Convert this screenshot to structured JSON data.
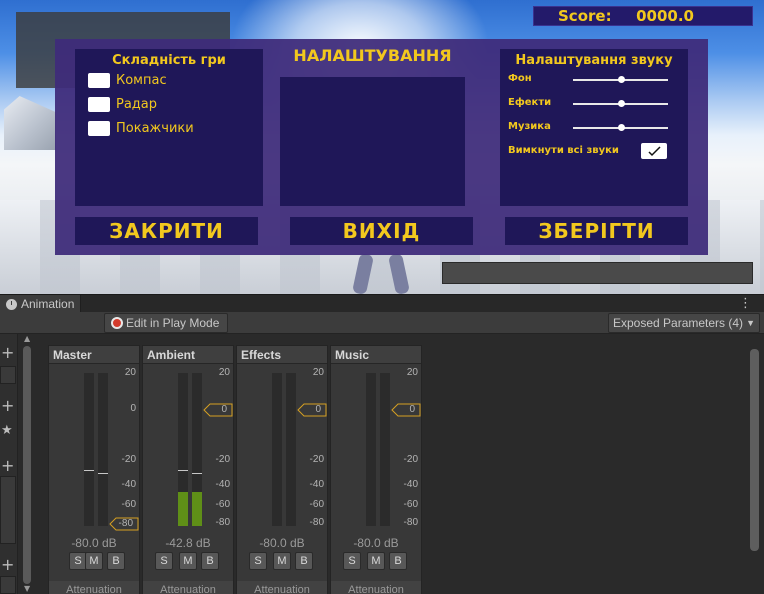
{
  "game": {
    "score_label": "Score:",
    "score_value": "0000.0",
    "settings_title": "НАЛАШТУВАННЯ",
    "difficulty": {
      "title": "Складність гри",
      "options": [
        "Компас",
        "Радар",
        "Покажчики"
      ]
    },
    "sound": {
      "title": "Налаштування звуку",
      "sliders": [
        {
          "label": "Фон",
          "value": 0.5
        },
        {
          "label": "Ефекти",
          "value": 0.5
        },
        {
          "label": "Музика",
          "value": 0.5
        }
      ],
      "mute_label": "Вимкнути всі звуки",
      "mute_checked": true
    },
    "buttons": {
      "close": "ЗАКРИТИ",
      "exit": "ВИХІД",
      "save": "ЗБЕРІГТИ"
    }
  },
  "editor": {
    "tab_label": "Animation",
    "edit_play_mode": "Edit in Play Mode",
    "exposed_params": "Exposed Parameters (4)",
    "scale_ticks": [
      "20",
      "0",
      "-20",
      "-40",
      "-60",
      "-80"
    ],
    "accent_color": "#5f8f17",
    "groups": [
      {
        "name": "Master",
        "db": "-80.0 dB",
        "fader": "-80",
        "level": 0.0,
        "attenuation": "Attenuation"
      },
      {
        "name": "Ambient",
        "db": "-42.8 dB",
        "fader": "0",
        "level": 0.22,
        "attenuation": "Attenuation"
      },
      {
        "name": "Effects",
        "db": "-80.0 dB",
        "fader": "0",
        "level": 0.0,
        "attenuation": "Attenuation"
      },
      {
        "name": "Music",
        "db": "-80.0 dB",
        "fader": "0",
        "level": 0.0,
        "attenuation": "Attenuation"
      }
    ],
    "smb": [
      "S",
      "M",
      "B"
    ]
  }
}
